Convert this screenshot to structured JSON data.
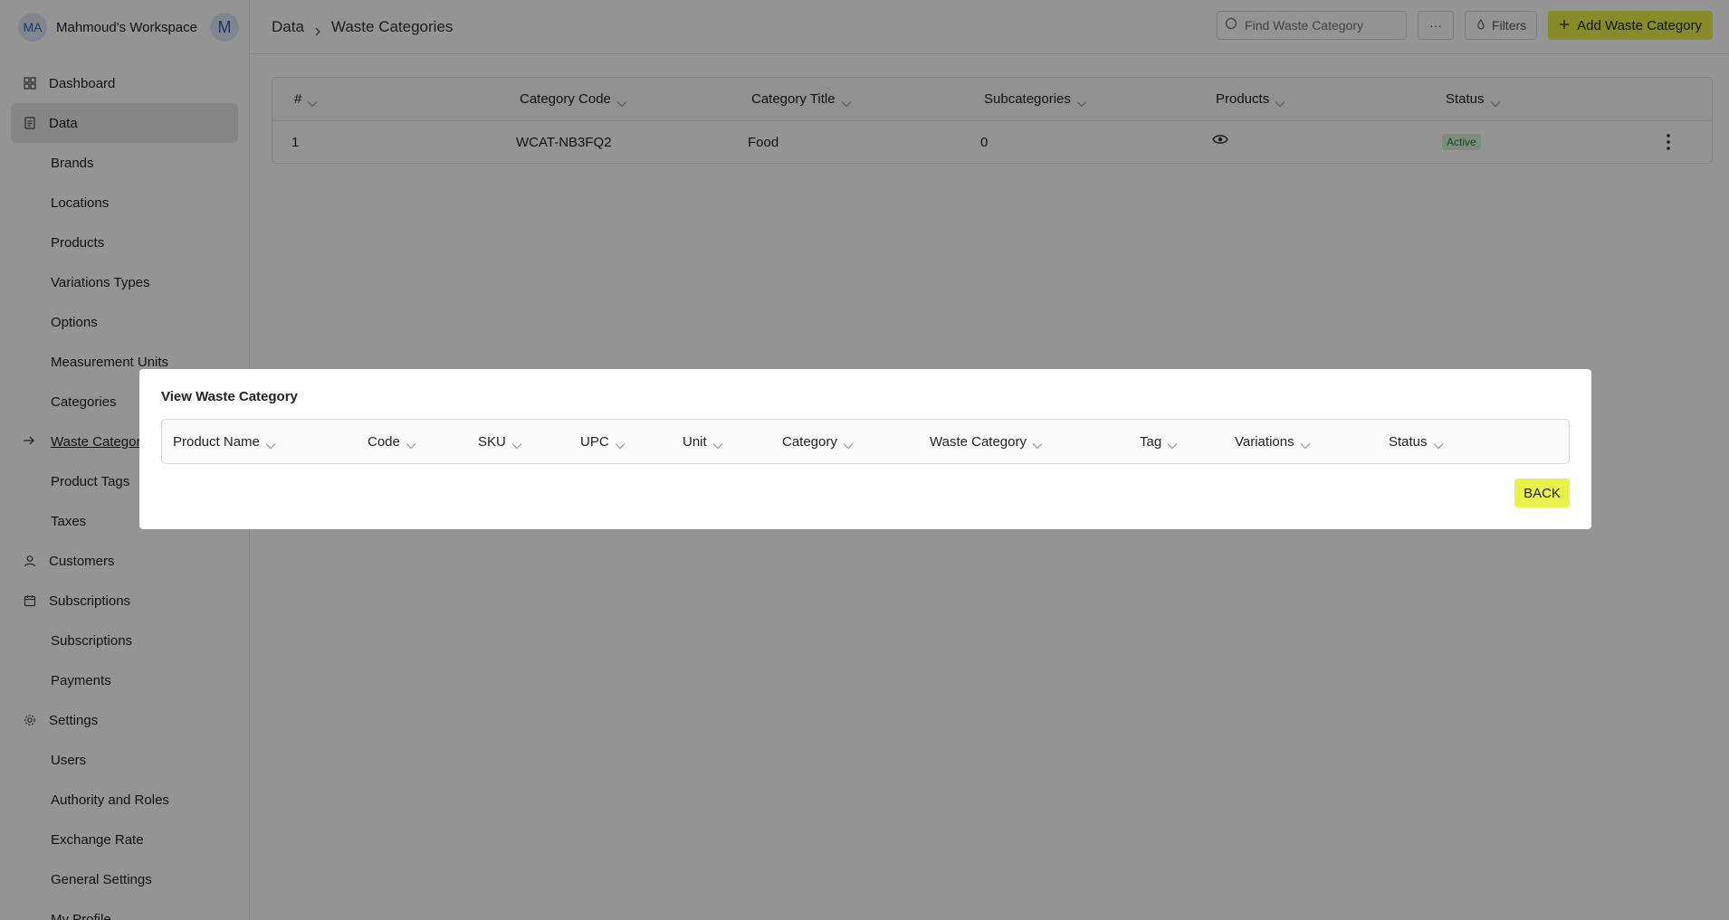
{
  "workspace": {
    "initials": "MA",
    "name": "Mahmoud's Workspace",
    "icon_letter": "M"
  },
  "sidebar": {
    "items": [
      {
        "label": "Dashboard"
      },
      {
        "label": "Data"
      },
      {
        "label": "Brands"
      },
      {
        "label": "Locations"
      },
      {
        "label": "Products"
      },
      {
        "label": "Variations Types"
      },
      {
        "label": "Options"
      },
      {
        "label": "Measurement Units"
      },
      {
        "label": "Categories"
      },
      {
        "label": "Waste Categories"
      },
      {
        "label": "Product Tags"
      },
      {
        "label": "Taxes"
      },
      {
        "label": "Customers"
      },
      {
        "label": "Subscriptions"
      },
      {
        "label": "Subscriptions"
      },
      {
        "label": "Payments"
      },
      {
        "label": "Settings"
      },
      {
        "label": "Users"
      },
      {
        "label": "Authority and Roles"
      },
      {
        "label": "Exchange Rate"
      },
      {
        "label": "General Settings"
      },
      {
        "label": "My Profile"
      }
    ]
  },
  "breadcrumb": {
    "parent": "Data",
    "current": "Waste Categories"
  },
  "toolbar": {
    "search_placeholder": "Find Waste Category",
    "more_label": "···",
    "filters_label": "Filters",
    "add_label": "Add Waste Category"
  },
  "table": {
    "headers": [
      "#",
      "Category Code",
      "Category Title",
      "Subcategories",
      "Products",
      "Status"
    ],
    "rows": [
      {
        "num": "1",
        "code": "WCAT-NB3FQ2",
        "title": "Food",
        "subcategories": "0",
        "status": "Active"
      }
    ]
  },
  "modal": {
    "title": "View Waste Category",
    "headers": [
      "Product Name",
      "Code",
      "SKU",
      "UPC",
      "Unit",
      "Category",
      "Waste Category",
      "Tag",
      "Variations",
      "Status"
    ],
    "back_label": "BACK"
  },
  "colors": {
    "accent": "#e8f24b",
    "active_badge_bg": "#d9f2dc",
    "active_badge_text": "#2b7a37"
  }
}
